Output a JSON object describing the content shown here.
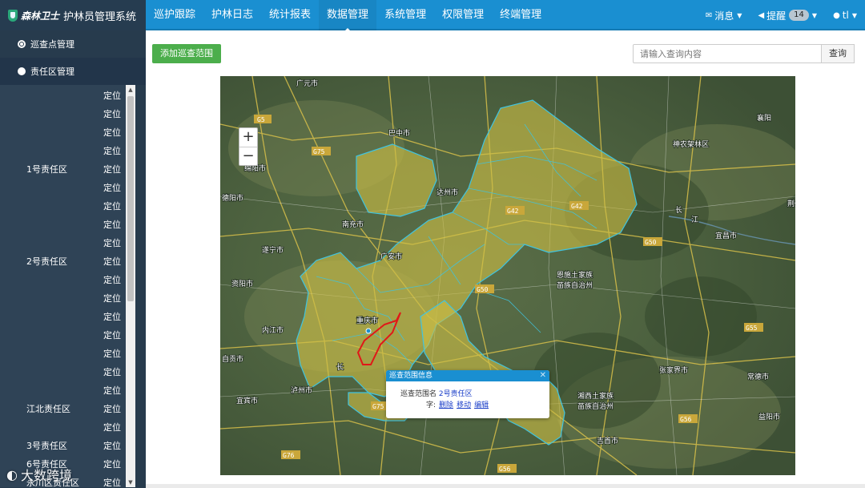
{
  "brand": {
    "logo_text": "森林卫士",
    "title": "护林员管理系统"
  },
  "nav": {
    "items": [
      "巡护跟踪",
      "护林日志",
      "统计报表",
      "数据管理",
      "系统管理",
      "权限管理",
      "终端管理"
    ],
    "active": "数据管理"
  },
  "nav_right": {
    "messages": "消息",
    "alerts": "提醒",
    "alert_count": "14",
    "user": "tl"
  },
  "sidebar": {
    "menus": [
      {
        "label": "巡查点管理"
      },
      {
        "label": "责任区管理"
      }
    ],
    "zones": [
      {
        "name": "",
        "loc": "定位"
      },
      {
        "name": "",
        "loc": "定位"
      },
      {
        "name": "",
        "loc": "定位"
      },
      {
        "name": "",
        "loc": "定位"
      },
      {
        "name": "1号责任区",
        "loc": "定位"
      },
      {
        "name": "",
        "loc": "定位"
      },
      {
        "name": "",
        "loc": "定位"
      },
      {
        "name": "",
        "loc": "定位"
      },
      {
        "name": "",
        "loc": "定位"
      },
      {
        "name": "2号责任区",
        "loc": "定位"
      },
      {
        "name": "",
        "loc": "定位"
      },
      {
        "name": "",
        "loc": "定位"
      },
      {
        "name": "",
        "loc": "定位"
      },
      {
        "name": "",
        "loc": "定位"
      },
      {
        "name": "",
        "loc": "定位"
      },
      {
        "name": "",
        "loc": "定位"
      },
      {
        "name": "",
        "loc": "定位"
      },
      {
        "name": "江北责任区",
        "loc": "定位"
      },
      {
        "name": "",
        "loc": "定位"
      },
      {
        "name": "3号责任区",
        "loc": "定位"
      },
      {
        "name": "6号责任区",
        "loc": "定位"
      },
      {
        "name": "永川区责任区",
        "loc": "定位"
      }
    ]
  },
  "toolbar": {
    "add_label": "添加巡查范围",
    "search_placeholder": "请输入查询内容",
    "search_label": "查询"
  },
  "map": {
    "zoom_in": "+",
    "zoom_out": "−",
    "labels": [
      "广元市",
      "巴中市",
      "达州市",
      "南充市",
      "广安市",
      "遂宁市",
      "绵阳市",
      "德阳市",
      "资阳市",
      "内江市",
      "自贡市",
      "宜宾市",
      "泸州市",
      "重庆市",
      "襄阳",
      "神农架林区",
      "宜昌市",
      "荆州",
      "恩施土家族苗族自治州",
      "张家界市",
      "常德市",
      "湘西土家族苗族自治州",
      "吉首市",
      "益阳市",
      "长江"
    ],
    "roads": [
      "G5",
      "G75",
      "G42",
      "G50",
      "G55",
      "G56",
      "G75",
      "G76",
      "G56"
    ]
  },
  "popup": {
    "title": "巡查范围信息",
    "name_label": "巡查范围名",
    "name_value": "2号责任区",
    "ops_label": "字:",
    "delete": "删除",
    "move": "移动",
    "edit": "编辑"
  },
  "watermark": "大数跨境"
}
